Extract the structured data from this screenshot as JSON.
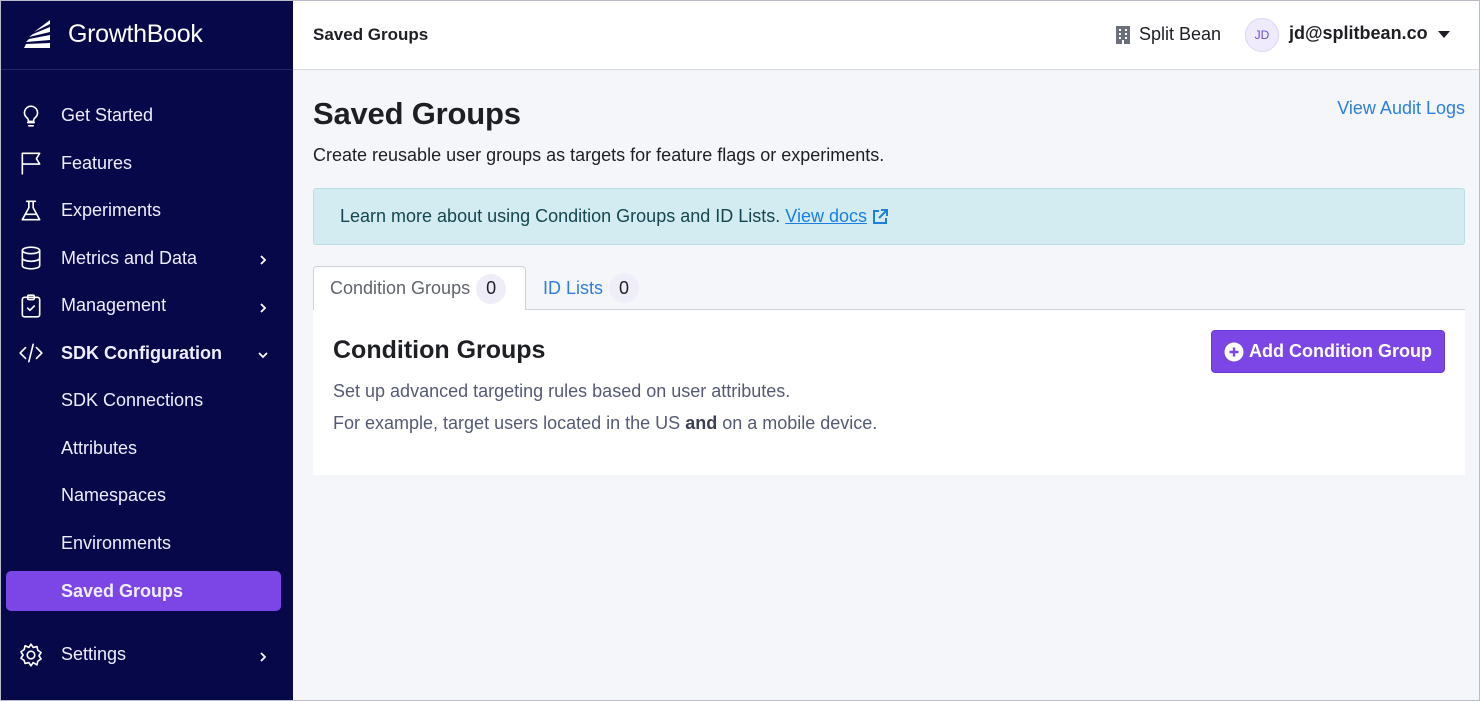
{
  "app": {
    "name": "GrowthBook"
  },
  "sidebar": {
    "items": [
      {
        "label": "Get Started",
        "icon": "lightbulb-icon"
      },
      {
        "label": "Features",
        "icon": "flag-icon"
      },
      {
        "label": "Experiments",
        "icon": "flask-icon"
      },
      {
        "label": "Metrics and Data",
        "icon": "database-icon",
        "expandable": true
      },
      {
        "label": "Management",
        "icon": "clipboard-check-icon",
        "expandable": true
      },
      {
        "label": "SDK Configuration",
        "icon": "code-icon",
        "expanded": true
      },
      {
        "label": "SDK Connections"
      },
      {
        "label": "Attributes"
      },
      {
        "label": "Namespaces"
      },
      {
        "label": "Environments"
      },
      {
        "label": "Saved Groups",
        "active": true
      },
      {
        "label": "Settings",
        "icon": "gear-icon",
        "expandable": true
      }
    ]
  },
  "topbar": {
    "title": "Saved Groups",
    "org_name": "Split Bean",
    "user_initials": "JD",
    "user_email": "jd@splitbean.co"
  },
  "page": {
    "title": "Saved Groups",
    "subtitle": "Create reusable user groups as targets for feature flags or experiments.",
    "audit_link": "View Audit Logs",
    "callout_text": "Learn more about using Condition Groups and ID Lists.",
    "callout_link": "View docs"
  },
  "tabs": [
    {
      "label": "Condition Groups",
      "count": "0",
      "active": true
    },
    {
      "label": "ID Lists",
      "count": "0",
      "active": false
    }
  ],
  "panel": {
    "title": "Condition Groups",
    "line1": "Set up advanced targeting rules based on user attributes.",
    "line2_pre": "For example, target users located in the US",
    "line2_bold": "and",
    "line2_post": "on a mobile device.",
    "add_button": "Add Condition Group"
  },
  "colors": {
    "sidebar_bg": "#07084a",
    "accent": "#7b46e5",
    "link": "#2e7fdc",
    "callout_bg": "#d3ecf1"
  }
}
